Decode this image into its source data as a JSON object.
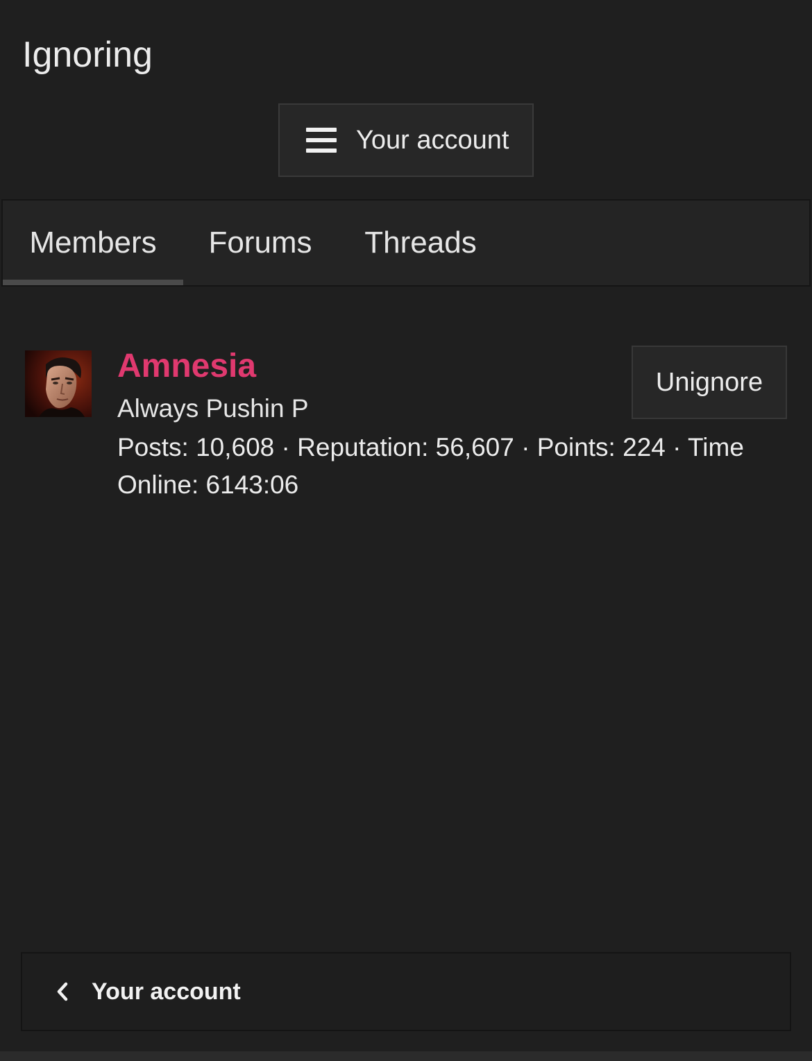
{
  "page": {
    "title": "Ignoring"
  },
  "account_menu": {
    "label": "Your account",
    "icon": "hamburger-menu-icon"
  },
  "tabs": [
    {
      "label": "Members",
      "active": true
    },
    {
      "label": "Forums",
      "active": false
    },
    {
      "label": "Threads",
      "active": false
    }
  ],
  "members": [
    {
      "username": "Amnesia",
      "user_title": "Always Pushin P",
      "stats": "Posts: 10,608 · Reputation: 56,607 · Points: 224 · Time Online: 6143:06",
      "action_label": "Unignore",
      "username_color": "#e0396f"
    }
  ],
  "footer_nav": {
    "label": "Your account",
    "icon": "chevron-left-icon"
  }
}
